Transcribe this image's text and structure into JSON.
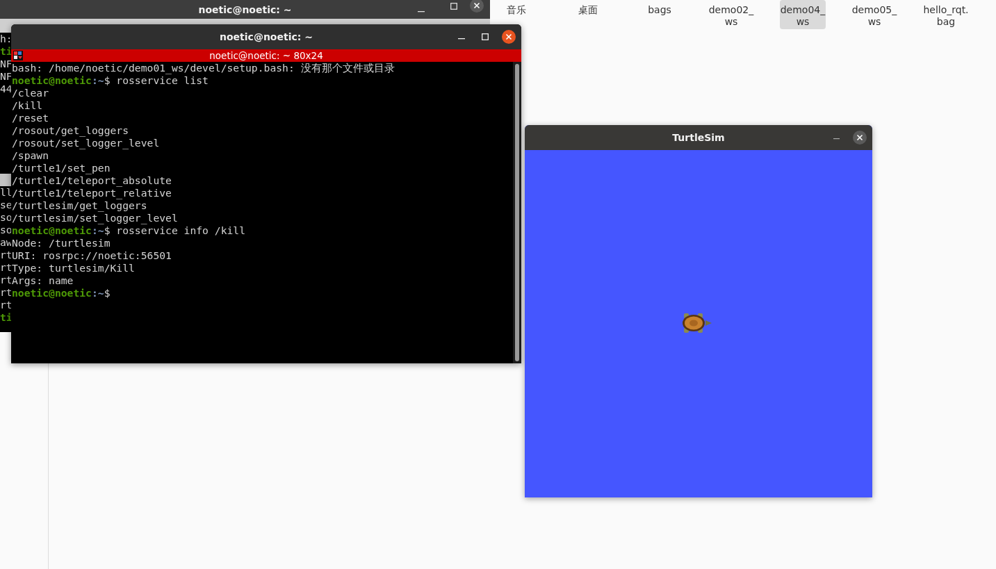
{
  "file_manager": {
    "files": [
      {
        "label": "音乐",
        "selected": false
      },
      {
        "label": "桌面",
        "selected": false
      },
      {
        "label": "bags",
        "selected": false
      },
      {
        "label": "demo02_\nws",
        "selected": false
      },
      {
        "label": "demo04_\nws",
        "selected": true
      },
      {
        "label": "demo05_\nws",
        "selected": false
      },
      {
        "label": "hello_rqt.\nbag",
        "selected": false
      }
    ]
  },
  "back_terminal": {
    "title": "noetic@noetic: ~",
    "top_fragments": [
      {
        "kind": "output",
        "text": "h:"
      },
      {
        "kind": "prompt",
        "text": "ti"
      },
      {
        "kind": "output",
        "text": "NF"
      },
      {
        "kind": "output",
        "text": "NF"
      },
      {
        "kind": "output",
        "text": "44"
      }
    ],
    "bottom_fragments": [
      {
        "kind": "cursor"
      },
      {
        "kind": "output",
        "text": "ll"
      },
      {
        "kind": "output",
        "text": "se"
      },
      {
        "kind": "output",
        "text": "so"
      },
      {
        "kind": "output",
        "text": "so"
      },
      {
        "kind": "output",
        "text": "aw"
      },
      {
        "kind": "output",
        "text": "rt"
      },
      {
        "kind": "output",
        "text": "rt"
      },
      {
        "kind": "output",
        "text": "rt"
      },
      {
        "kind": "output",
        "text": "rt"
      },
      {
        "kind": "output",
        "text": "rt"
      },
      {
        "kind": "prompt",
        "text": "ti"
      }
    ]
  },
  "front_terminal": {
    "title": "noetic@noetic: ~",
    "header": "noetic@noetic: ~ 80x24",
    "lines": [
      {
        "kind": "output",
        "text": "bash: /home/noetic/demo01_ws/devel/setup.bash: 没有那个文件或目录"
      },
      {
        "kind": "prompt",
        "user": "noetic@noetic",
        "path": ":~",
        "sigil": "$",
        "command": "rosservice list"
      },
      {
        "kind": "output",
        "text": "/clear"
      },
      {
        "kind": "output",
        "text": "/kill"
      },
      {
        "kind": "output",
        "text": "/reset"
      },
      {
        "kind": "output",
        "text": "/rosout/get_loggers"
      },
      {
        "kind": "output",
        "text": "/rosout/set_logger_level"
      },
      {
        "kind": "output",
        "text": "/spawn"
      },
      {
        "kind": "output",
        "text": "/turtle1/set_pen"
      },
      {
        "kind": "output",
        "text": "/turtle1/teleport_absolute"
      },
      {
        "kind": "output",
        "text": "/turtle1/teleport_relative"
      },
      {
        "kind": "output",
        "text": "/turtlesim/get_loggers"
      },
      {
        "kind": "output",
        "text": "/turtlesim/set_logger_level"
      },
      {
        "kind": "prompt",
        "user": "noetic@noetic",
        "path": ":~",
        "sigil": "$",
        "command": "rosservice info /kill"
      },
      {
        "kind": "output",
        "text": "Node: /turtlesim"
      },
      {
        "kind": "output",
        "text": "URI: rosrpc://noetic:56501"
      },
      {
        "kind": "output",
        "text": "Type: turtlesim/Kill"
      },
      {
        "kind": "output",
        "text": "Args: name"
      },
      {
        "kind": "prompt",
        "user": "noetic@noetic",
        "path": ":~",
        "sigil": "$"
      }
    ]
  },
  "turtlesim": {
    "title": "TurtleSim"
  }
}
